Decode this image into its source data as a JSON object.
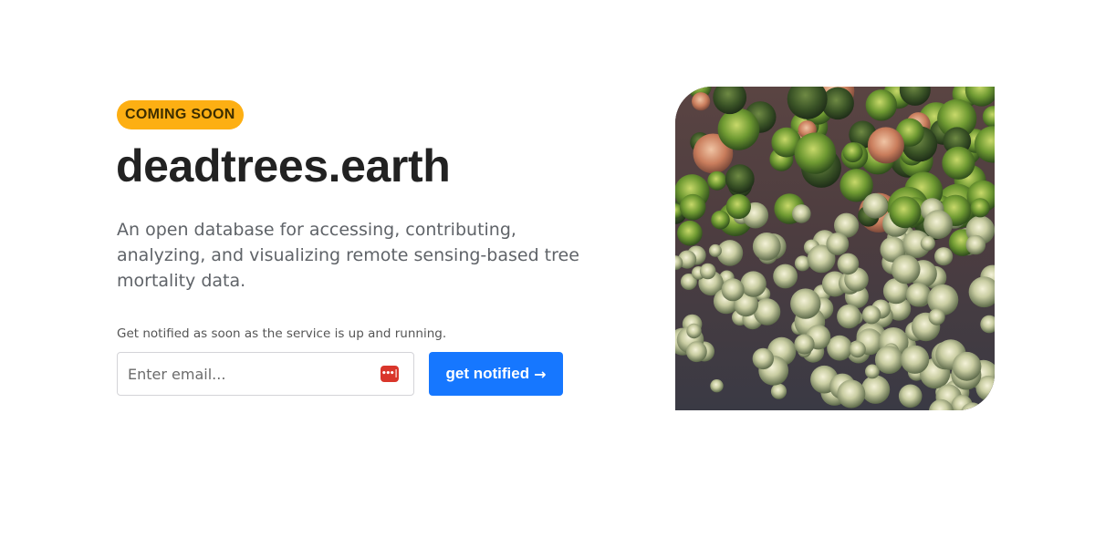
{
  "hero": {
    "badge": "COMING SOON",
    "title": "deadtrees.earth",
    "description": "An open database for accessing, contributing, analyzing, and visualizing remote sensing-based tree mortality data."
  },
  "signup": {
    "label": "Get notified as soon as the service is up and running.",
    "email_placeholder": "Enter email...",
    "email_value": "",
    "button_label": "get notified",
    "button_arrow": "→"
  },
  "photo": {
    "icon": "aerial-forest-image"
  },
  "colors": {
    "badge": "#FDAF13",
    "button": "#1677FF",
    "title": "#222222",
    "description": "#5f6368",
    "password_manager_icon": "#d9362b"
  }
}
